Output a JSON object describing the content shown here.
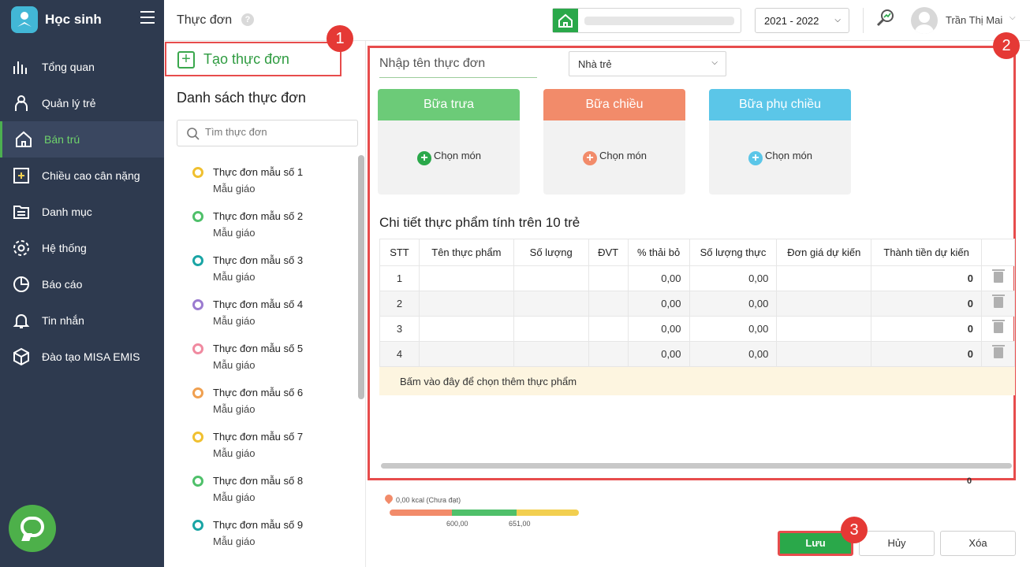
{
  "app": {
    "title": "Học sinh"
  },
  "sidebar": {
    "items": [
      {
        "label": "Tổng quan",
        "icon": "bar-chart-icon"
      },
      {
        "label": "Quản lý trẻ",
        "icon": "child-icon"
      },
      {
        "label": "Bán trú",
        "icon": "home-icon",
        "active": true
      },
      {
        "label": "Chiều cao cân nặng",
        "icon": "growth-icon"
      },
      {
        "label": "Danh mục",
        "icon": "folder-icon"
      },
      {
        "label": "Hệ thống",
        "icon": "gear-icon"
      },
      {
        "label": "Báo cáo",
        "icon": "pie-chart-icon"
      },
      {
        "label": "Tin nhắn",
        "icon": "bell-icon"
      },
      {
        "label": "Đào tạo MISA EMIS",
        "icon": "box-icon"
      }
    ]
  },
  "topbar": {
    "page_title": "Thực đơn",
    "help": "?",
    "school_year": "2021 - 2022",
    "user_name": "Trần Thị Mai"
  },
  "left_panel": {
    "create_label": "Tạo thực đơn",
    "list_title": "Danh sách thực đơn",
    "search_placeholder": "Tìm thực đơn",
    "menus": [
      {
        "name": "Thực đơn mẫu số 1",
        "group": "Mẫu giáo",
        "color": "#f0c030"
      },
      {
        "name": "Thực đơn mẫu số 2",
        "group": "Mẫu giáo",
        "color": "#4fc06a"
      },
      {
        "name": "Thực đơn mẫu số 3",
        "group": "Mẫu giáo",
        "color": "#1aa5a5"
      },
      {
        "name": "Thực đơn mẫu số 4",
        "group": "Mẫu giáo",
        "color": "#9b7bd0"
      },
      {
        "name": "Thực đơn mẫu số 5",
        "group": "Mẫu giáo",
        "color": "#f08aa0"
      },
      {
        "name": "Thực đơn mẫu số 6",
        "group": "Mẫu giáo",
        "color": "#f0a050"
      },
      {
        "name": "Thực đơn mẫu số 7",
        "group": "Mẫu giáo",
        "color": "#f0c030"
      },
      {
        "name": "Thực đơn mẫu số 8",
        "group": "Mẫu giáo",
        "color": "#4fc06a"
      },
      {
        "name": "Thực đơn mẫu số 9",
        "group": "Mẫu giáo",
        "color": "#1aa5a5"
      }
    ]
  },
  "editor": {
    "name_placeholder": "Nhập tên thực đơn",
    "group_select": "Nhà trẻ",
    "meals": [
      {
        "title": "Bữa trưa",
        "color": "#6ccb78",
        "pick_label": "Chọn món",
        "pick_color": "#2aa84a"
      },
      {
        "title": "Bữa chiều",
        "color": "#f28b6a",
        "pick_label": "Chọn món",
        "pick_color": "#f28b6a"
      },
      {
        "title": "Bữa phụ chiều",
        "color": "#5bc6e8",
        "pick_label": "Chọn món",
        "pick_color": "#5bc6e8"
      }
    ],
    "detail_title": "Chi tiết thực phẩm tính trên 10 trẻ",
    "columns": [
      "STT",
      "Tên thực phẩm",
      "Số lượng",
      "ĐVT",
      "% thải bỏ",
      "Số lượng thực",
      "Đơn giá dự kiến",
      "Thành tiền dự kiến"
    ],
    "rows": [
      {
        "stt": "1",
        "thai_bo": "0,00",
        "so_luong_thuc": "0,00",
        "thanh_tien": "0"
      },
      {
        "stt": "2",
        "thai_bo": "0,00",
        "so_luong_thuc": "0,00",
        "thanh_tien": "0"
      },
      {
        "stt": "3",
        "thai_bo": "0,00",
        "so_luong_thuc": "0,00",
        "thanh_tien": "0"
      },
      {
        "stt": "4",
        "thai_bo": "0,00",
        "so_luong_thuc": "0,00",
        "thanh_tien": "0"
      }
    ],
    "add_hint": "Bấm vào đây để chọn thêm thực phẩm",
    "total_below": "0"
  },
  "energy": {
    "label": "0,00 kcal (Chưa đạt)",
    "tick_low": "600,00",
    "tick_high": "651,00",
    "segments": [
      "#f28b6a",
      "#4fc06a",
      "#f2cf50"
    ]
  },
  "actions": {
    "save": "Lưu",
    "cancel": "Hủy",
    "delete": "Xóa"
  },
  "badges": [
    "1",
    "2",
    "3"
  ]
}
